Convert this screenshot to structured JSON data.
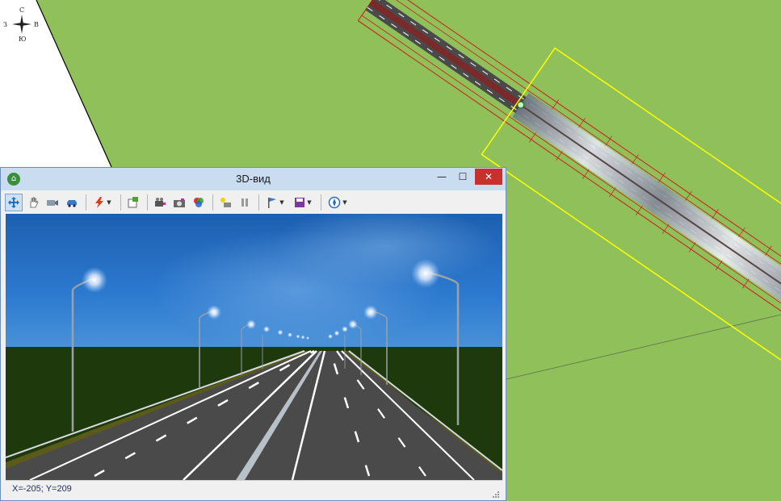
{
  "compass": {
    "north": "С",
    "south": "Ю",
    "west": "З",
    "east": "В"
  },
  "window": {
    "title": "3D-вид",
    "minimize_glyph": "—",
    "maximize_glyph": "☐",
    "close_glyph": "✕"
  },
  "toolbar": {
    "icons": [
      "move-icon",
      "pan-hand-icon",
      "camera-icon",
      "car-icon",
      "lightning-icon",
      "settings-icon",
      "video-camera-icon",
      "photo-icon",
      "color-palette-icon",
      "light-icon",
      "pause-icon",
      "flag-icon",
      "save-icon",
      "compass-icon"
    ]
  },
  "status": {
    "coordinates": "X=-205; Y=209"
  },
  "colors": {
    "ground": "#8fc05a",
    "road_outline": "#d01818",
    "selection": "#ffff00",
    "window_border": "#6b8fb8",
    "titlebar": "#c9dcf0",
    "close_button": "#c7302b"
  }
}
